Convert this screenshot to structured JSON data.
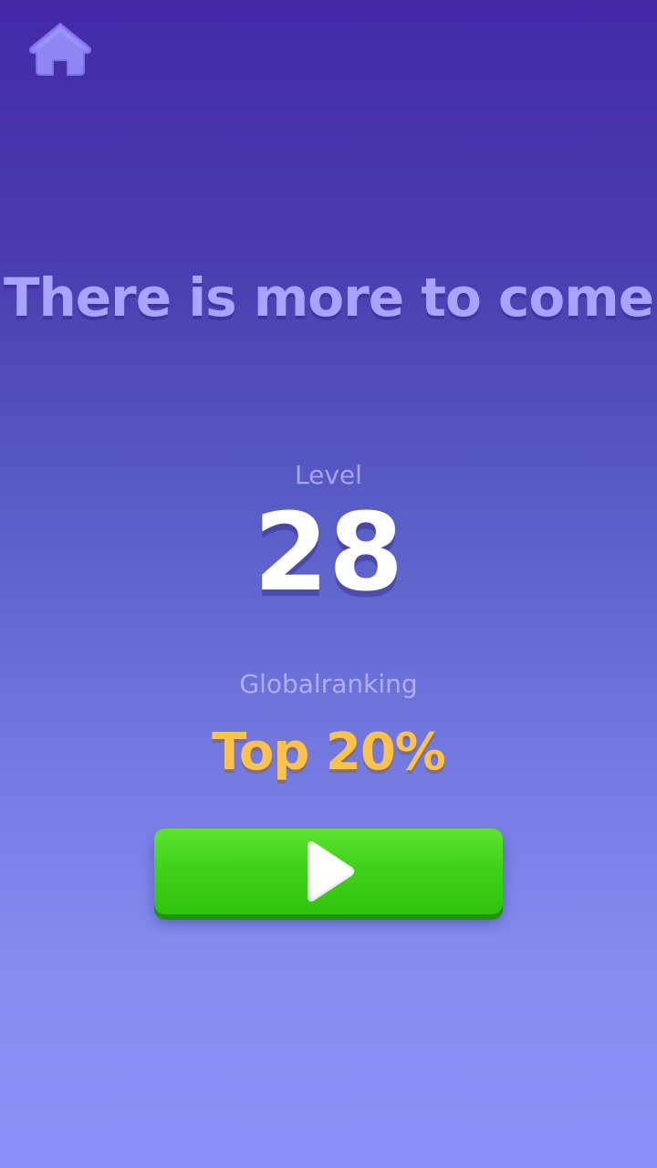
{
  "headline": "There is more to come",
  "level": {
    "label": "Level",
    "value": "28"
  },
  "ranking": {
    "label": "Globalranking",
    "value": "Top 20%"
  },
  "icons": {
    "home": "home-icon",
    "play": "play-icon"
  },
  "colors": {
    "background_top": "#4429a9",
    "background_bottom": "#8b91f6",
    "headline": "#a8a4ff",
    "ranking_value": "#fcc24a",
    "play_button": "#3fd21a",
    "home_icon": "#8f86f4"
  }
}
